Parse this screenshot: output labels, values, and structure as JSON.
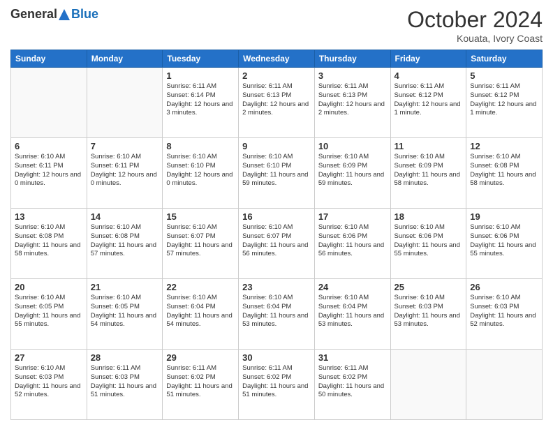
{
  "header": {
    "logo": {
      "general": "General",
      "blue": "Blue"
    },
    "month": "October 2024",
    "location": "Kouata, Ivory Coast"
  },
  "weekdays": [
    "Sunday",
    "Monday",
    "Tuesday",
    "Wednesday",
    "Thursday",
    "Friday",
    "Saturday"
  ],
  "weeks": [
    [
      {
        "day": "",
        "detail": ""
      },
      {
        "day": "",
        "detail": ""
      },
      {
        "day": "1",
        "detail": "Sunrise: 6:11 AM\nSunset: 6:14 PM\nDaylight: 12 hours\nand 3 minutes."
      },
      {
        "day": "2",
        "detail": "Sunrise: 6:11 AM\nSunset: 6:13 PM\nDaylight: 12 hours\nand 2 minutes."
      },
      {
        "day": "3",
        "detail": "Sunrise: 6:11 AM\nSunset: 6:13 PM\nDaylight: 12 hours\nand 2 minutes."
      },
      {
        "day": "4",
        "detail": "Sunrise: 6:11 AM\nSunset: 6:12 PM\nDaylight: 12 hours\nand 1 minute."
      },
      {
        "day": "5",
        "detail": "Sunrise: 6:11 AM\nSunset: 6:12 PM\nDaylight: 12 hours\nand 1 minute."
      }
    ],
    [
      {
        "day": "6",
        "detail": "Sunrise: 6:10 AM\nSunset: 6:11 PM\nDaylight: 12 hours\nand 0 minutes."
      },
      {
        "day": "7",
        "detail": "Sunrise: 6:10 AM\nSunset: 6:11 PM\nDaylight: 12 hours\nand 0 minutes."
      },
      {
        "day": "8",
        "detail": "Sunrise: 6:10 AM\nSunset: 6:10 PM\nDaylight: 12 hours\nand 0 minutes."
      },
      {
        "day": "9",
        "detail": "Sunrise: 6:10 AM\nSunset: 6:10 PM\nDaylight: 11 hours\nand 59 minutes."
      },
      {
        "day": "10",
        "detail": "Sunrise: 6:10 AM\nSunset: 6:09 PM\nDaylight: 11 hours\nand 59 minutes."
      },
      {
        "day": "11",
        "detail": "Sunrise: 6:10 AM\nSunset: 6:09 PM\nDaylight: 11 hours\nand 58 minutes."
      },
      {
        "day": "12",
        "detail": "Sunrise: 6:10 AM\nSunset: 6:08 PM\nDaylight: 11 hours\nand 58 minutes."
      }
    ],
    [
      {
        "day": "13",
        "detail": "Sunrise: 6:10 AM\nSunset: 6:08 PM\nDaylight: 11 hours\nand 58 minutes."
      },
      {
        "day": "14",
        "detail": "Sunrise: 6:10 AM\nSunset: 6:08 PM\nDaylight: 11 hours\nand 57 minutes."
      },
      {
        "day": "15",
        "detail": "Sunrise: 6:10 AM\nSunset: 6:07 PM\nDaylight: 11 hours\nand 57 minutes."
      },
      {
        "day": "16",
        "detail": "Sunrise: 6:10 AM\nSunset: 6:07 PM\nDaylight: 11 hours\nand 56 minutes."
      },
      {
        "day": "17",
        "detail": "Sunrise: 6:10 AM\nSunset: 6:06 PM\nDaylight: 11 hours\nand 56 minutes."
      },
      {
        "day": "18",
        "detail": "Sunrise: 6:10 AM\nSunset: 6:06 PM\nDaylight: 11 hours\nand 55 minutes."
      },
      {
        "day": "19",
        "detail": "Sunrise: 6:10 AM\nSunset: 6:06 PM\nDaylight: 11 hours\nand 55 minutes."
      }
    ],
    [
      {
        "day": "20",
        "detail": "Sunrise: 6:10 AM\nSunset: 6:05 PM\nDaylight: 11 hours\nand 55 minutes."
      },
      {
        "day": "21",
        "detail": "Sunrise: 6:10 AM\nSunset: 6:05 PM\nDaylight: 11 hours\nand 54 minutes."
      },
      {
        "day": "22",
        "detail": "Sunrise: 6:10 AM\nSunset: 6:04 PM\nDaylight: 11 hours\nand 54 minutes."
      },
      {
        "day": "23",
        "detail": "Sunrise: 6:10 AM\nSunset: 6:04 PM\nDaylight: 11 hours\nand 53 minutes."
      },
      {
        "day": "24",
        "detail": "Sunrise: 6:10 AM\nSunset: 6:04 PM\nDaylight: 11 hours\nand 53 minutes."
      },
      {
        "day": "25",
        "detail": "Sunrise: 6:10 AM\nSunset: 6:03 PM\nDaylight: 11 hours\nand 53 minutes."
      },
      {
        "day": "26",
        "detail": "Sunrise: 6:10 AM\nSunset: 6:03 PM\nDaylight: 11 hours\nand 52 minutes."
      }
    ],
    [
      {
        "day": "27",
        "detail": "Sunrise: 6:10 AM\nSunset: 6:03 PM\nDaylight: 11 hours\nand 52 minutes."
      },
      {
        "day": "28",
        "detail": "Sunrise: 6:11 AM\nSunset: 6:03 PM\nDaylight: 11 hours\nand 51 minutes."
      },
      {
        "day": "29",
        "detail": "Sunrise: 6:11 AM\nSunset: 6:02 PM\nDaylight: 11 hours\nand 51 minutes."
      },
      {
        "day": "30",
        "detail": "Sunrise: 6:11 AM\nSunset: 6:02 PM\nDaylight: 11 hours\nand 51 minutes."
      },
      {
        "day": "31",
        "detail": "Sunrise: 6:11 AM\nSunset: 6:02 PM\nDaylight: 11 hours\nand 50 minutes."
      },
      {
        "day": "",
        "detail": ""
      },
      {
        "day": "",
        "detail": ""
      }
    ]
  ]
}
